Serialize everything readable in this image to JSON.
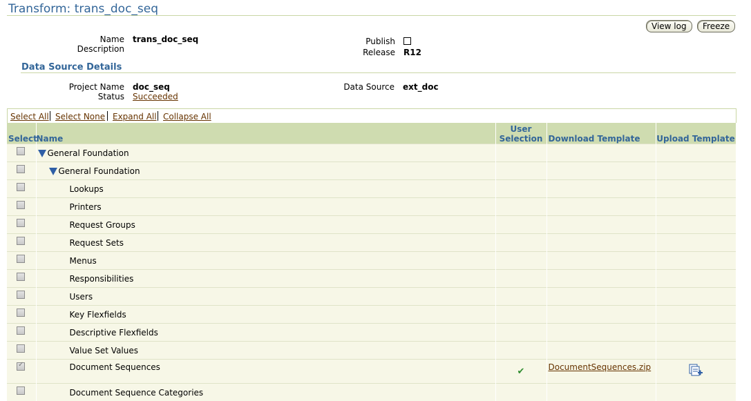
{
  "page": {
    "title": "Transform: trans_doc_seq"
  },
  "buttons": {
    "view_log": "View log",
    "freeze": "Freeze"
  },
  "details": {
    "name_label": "Name",
    "name_value": "trans_doc_seq",
    "description_label": "Description",
    "publish_label": "Publish",
    "publish_checked": false,
    "release_label": "Release",
    "release_value": "R12"
  },
  "data_source": {
    "heading": "Data Source Details",
    "project_name_label": "Project Name",
    "project_name_value": "doc_seq",
    "status_label": "Status",
    "status_value": "Succeeded",
    "data_source_label": "Data Source",
    "data_source_value": "ext_doc"
  },
  "table_controls": [
    "Select All",
    "Select None",
    "Expand All",
    "Collapse All"
  ],
  "table": {
    "headers": {
      "select": "Select",
      "name": "Name",
      "user_selection_line1": "User",
      "user_selection_line2": "Selection",
      "download_template": "Download Template",
      "upload_template": "Upload Template"
    },
    "rows": [
      {
        "name": "General Foundation",
        "level": 0,
        "expandable": true,
        "checked": false,
        "user_selection": false,
        "download": ""
      },
      {
        "name": "General Foundation",
        "level": 1,
        "expandable": true,
        "checked": false,
        "user_selection": false,
        "download": ""
      },
      {
        "name": "Lookups",
        "level": 2,
        "expandable": false,
        "checked": false,
        "user_selection": false,
        "download": ""
      },
      {
        "name": "Printers",
        "level": 2,
        "expandable": false,
        "checked": false,
        "user_selection": false,
        "download": ""
      },
      {
        "name": "Request Groups",
        "level": 2,
        "expandable": false,
        "checked": false,
        "user_selection": false,
        "download": ""
      },
      {
        "name": "Request Sets",
        "level": 2,
        "expandable": false,
        "checked": false,
        "user_selection": false,
        "download": ""
      },
      {
        "name": "Menus",
        "level": 2,
        "expandable": false,
        "checked": false,
        "user_selection": false,
        "download": ""
      },
      {
        "name": "Responsibilities",
        "level": 2,
        "expandable": false,
        "checked": false,
        "user_selection": false,
        "download": ""
      },
      {
        "name": "Users",
        "level": 2,
        "expandable": false,
        "checked": false,
        "user_selection": false,
        "download": ""
      },
      {
        "name": "Key Flexfields",
        "level": 2,
        "expandable": false,
        "checked": false,
        "user_selection": false,
        "download": ""
      },
      {
        "name": "Descriptive Flexfields",
        "level": 2,
        "expandable": false,
        "checked": false,
        "user_selection": false,
        "download": ""
      },
      {
        "name": "Value Set Values",
        "level": 2,
        "expandable": false,
        "checked": false,
        "user_selection": false,
        "download": ""
      },
      {
        "name": "Document Sequences",
        "level": 2,
        "expandable": false,
        "checked": true,
        "user_selection": true,
        "download": "DocumentSequences.zip",
        "upload_icon": "upload-template-icon"
      },
      {
        "name": "Document Sequence Categories",
        "level": 2,
        "expandable": false,
        "checked": false,
        "user_selection": false,
        "download": ""
      }
    ]
  }
}
